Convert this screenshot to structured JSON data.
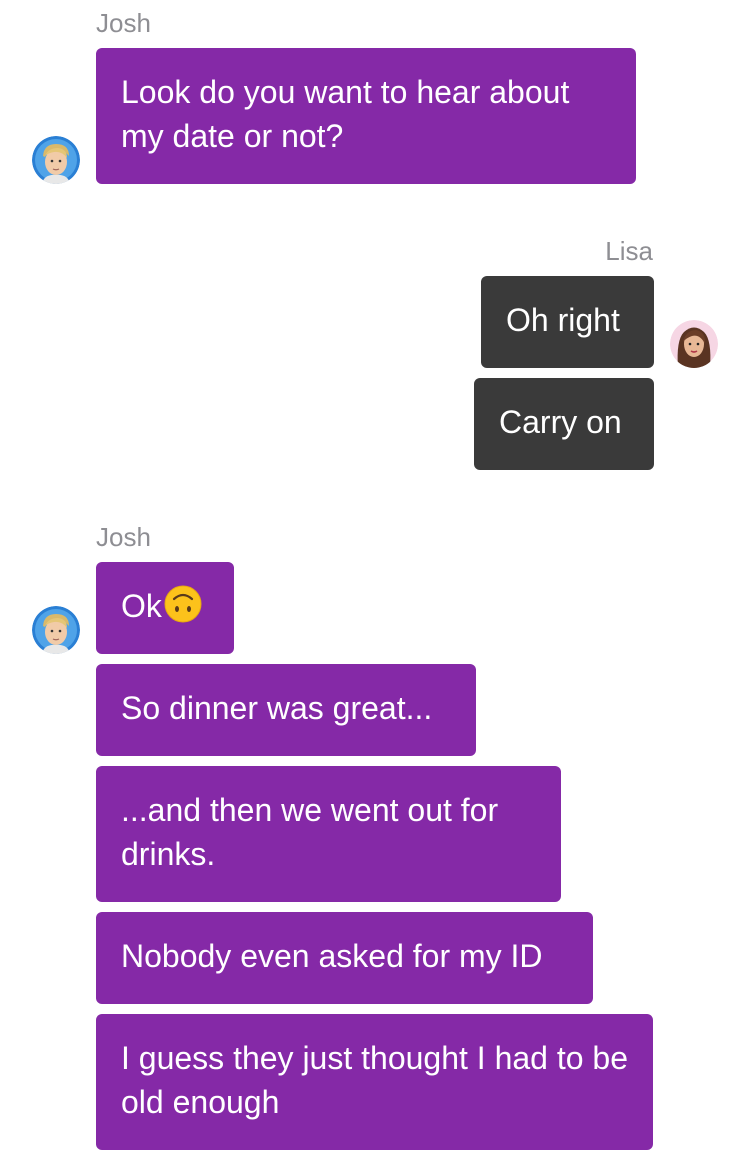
{
  "thread": {
    "group1": {
      "sender": "Josh",
      "messages": [
        "Look do you want to hear about my date or not?"
      ]
    },
    "group2": {
      "sender": "Lisa",
      "messages": [
        "Oh right",
        "Carry on"
      ]
    },
    "group3": {
      "sender": "Josh",
      "messages": [
        "Ok",
        "So dinner was great...",
        "...and then we went out for drinks.",
        "Nobody even asked for my ID",
        "I guess they just thought I had to be old enough"
      ],
      "emoji": "upside-down-face-icon"
    }
  },
  "colors": {
    "josh_bubble": "#8529a7",
    "lisa_bubble": "#3a3a3a",
    "name_text": "#8e8e93"
  }
}
